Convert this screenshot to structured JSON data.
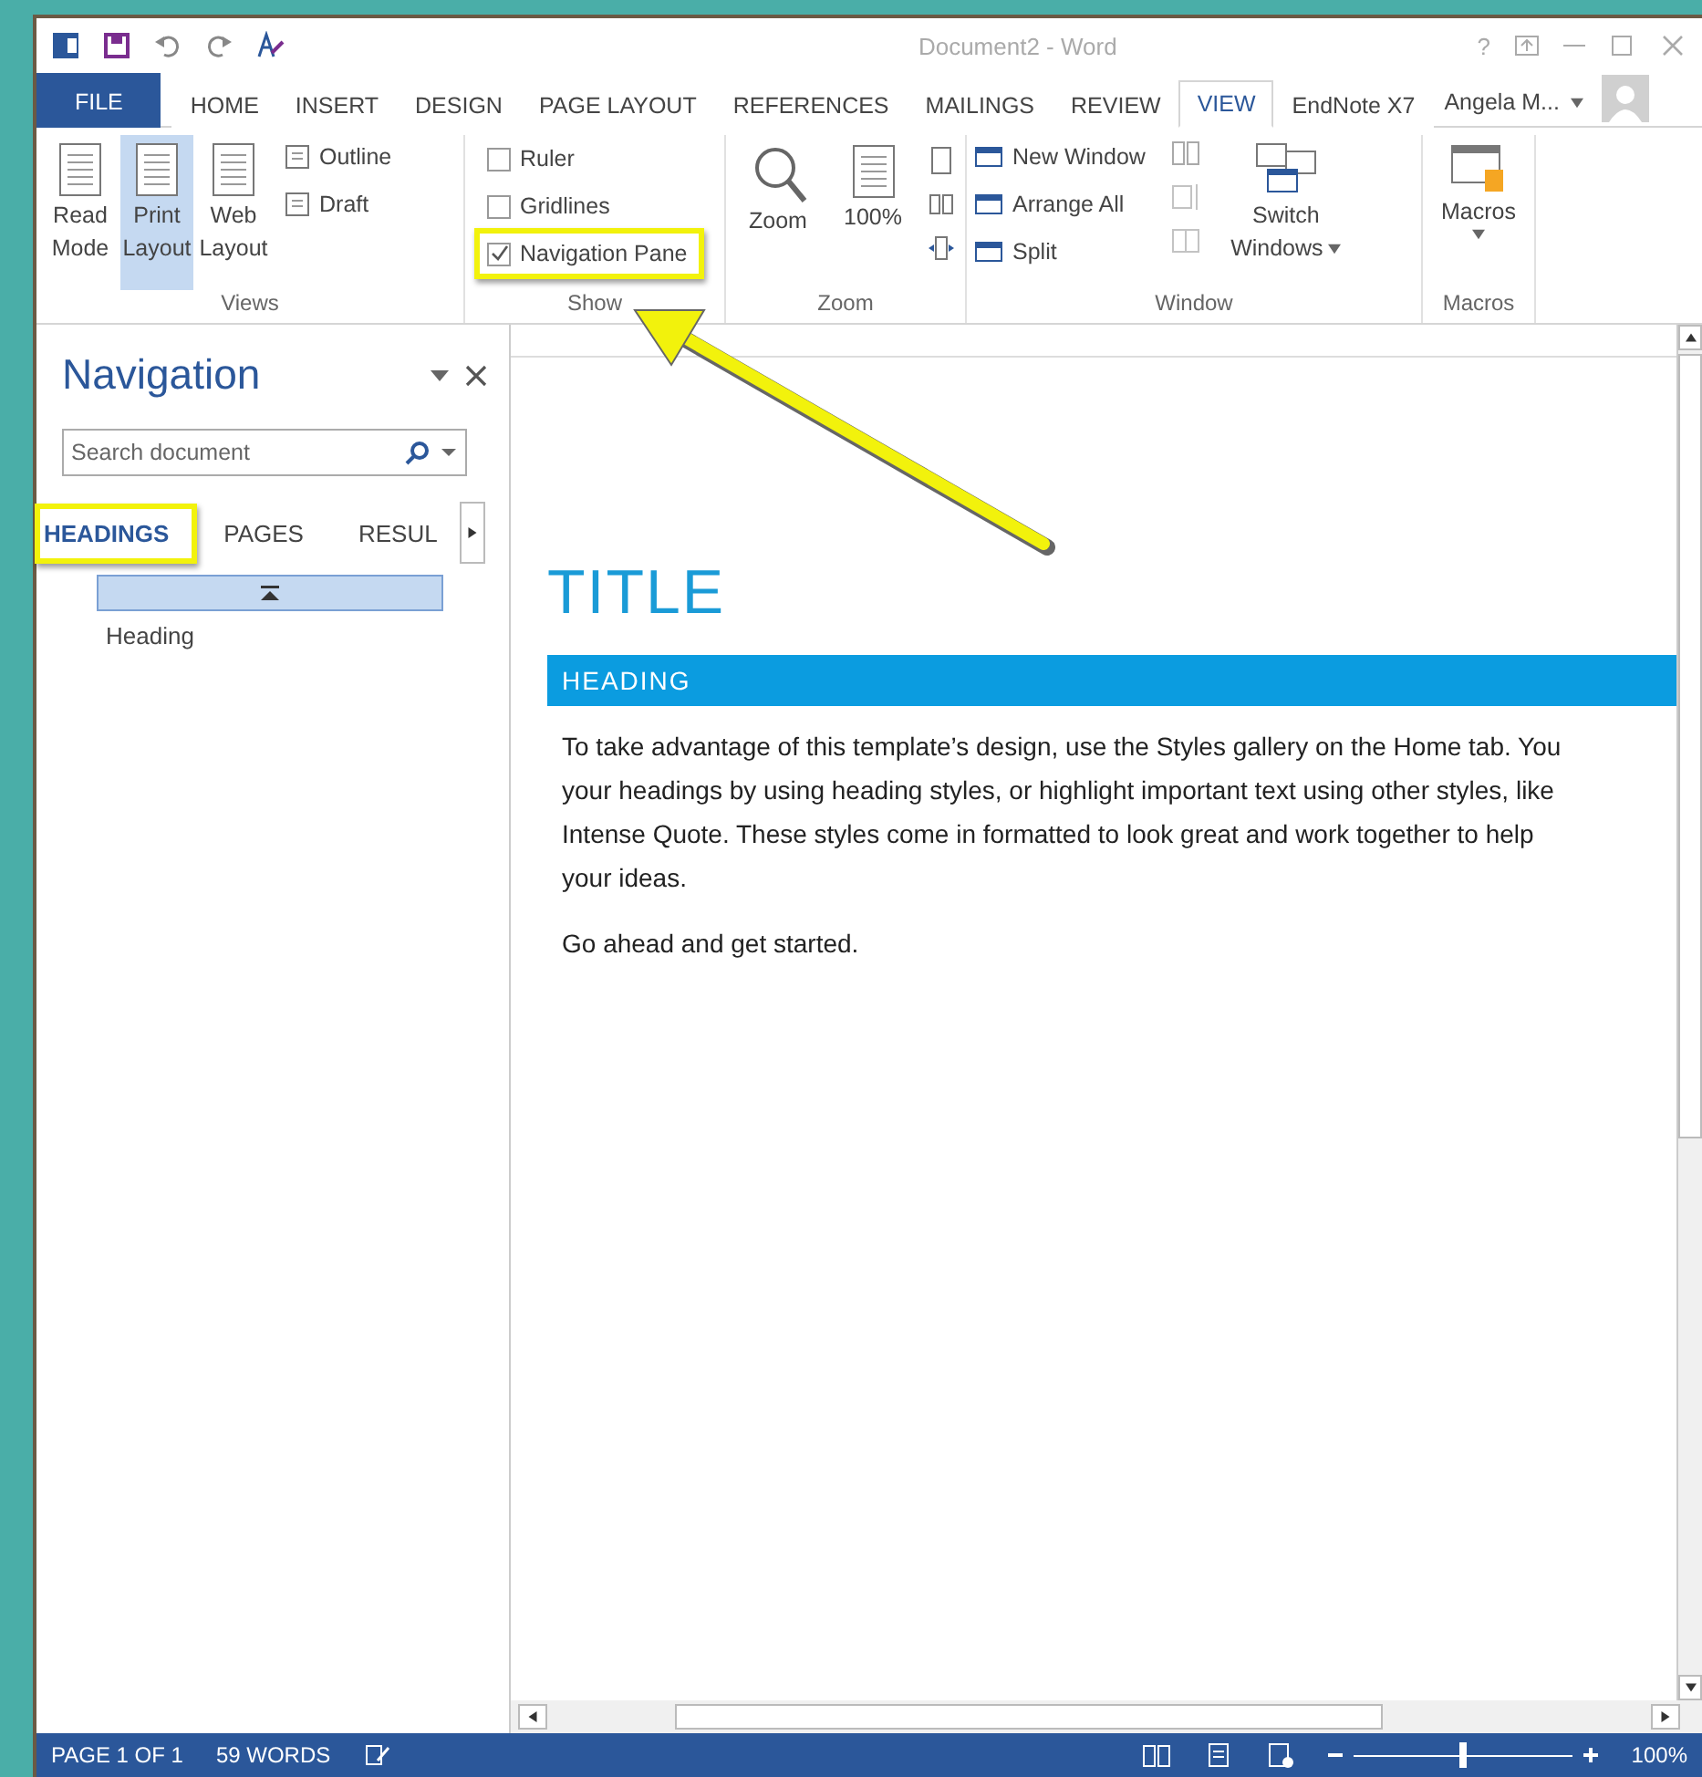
{
  "title_bar": {
    "title": "Document2 - Word",
    "help": "?"
  },
  "ribbon_tabs": [
    {
      "label": "FILE",
      "kind": "file",
      "selected": false
    },
    {
      "label": "HOME",
      "kind": "tab",
      "selected": false
    },
    {
      "label": "INSERT",
      "kind": "tab",
      "selected": false
    },
    {
      "label": "DESIGN",
      "kind": "tab",
      "selected": false
    },
    {
      "label": "PAGE LAYOUT",
      "kind": "tab",
      "selected": false
    },
    {
      "label": "REFERENCES",
      "kind": "tab",
      "selected": false
    },
    {
      "label": "MAILINGS",
      "kind": "tab",
      "selected": false
    },
    {
      "label": "REVIEW",
      "kind": "tab",
      "selected": false
    },
    {
      "label": "VIEW",
      "kind": "tab",
      "selected": true
    },
    {
      "label": "EndNote X7",
      "kind": "tab",
      "selected": false
    }
  ],
  "user": "Angela M...",
  "ribbon": {
    "views": {
      "label": "Views",
      "large": [
        {
          "line1": "Read",
          "line2": "Mode",
          "selected": false
        },
        {
          "line1": "Print",
          "line2": "Layout",
          "selected": true
        },
        {
          "line1": "Web",
          "line2": "Layout",
          "selected": false
        }
      ],
      "small": [
        "Outline",
        "Draft"
      ]
    },
    "show": {
      "label": "Show",
      "checkboxes": [
        {
          "label": "Ruler",
          "checked": false,
          "highlighted": false
        },
        {
          "label": "Gridlines",
          "checked": false,
          "highlighted": false
        },
        {
          "label": "Navigation Pane",
          "checked": true,
          "highlighted": true
        }
      ]
    },
    "zoom": {
      "label": "Zoom",
      "buttons": [
        "Zoom",
        "100%"
      ]
    },
    "window": {
      "label": "Window",
      "small": [
        "New Window",
        "Arrange All",
        "Split"
      ],
      "switch": {
        "line1": "Switch",
        "line2": "Windows"
      }
    },
    "macros": {
      "label": "Macros",
      "button": "Macros"
    }
  },
  "navigation": {
    "title": "Navigation",
    "search": {
      "placeholder": "Search document"
    },
    "tabs": [
      {
        "label": "HEADINGS",
        "selected": true,
        "highlighted": true
      },
      {
        "label": "PAGES",
        "selected": false,
        "highlighted": false
      },
      {
        "label": "RESUL",
        "selected": false,
        "highlighted": false
      }
    ],
    "headings": [
      "Heading"
    ]
  },
  "document": {
    "title": "TITLE",
    "heading": "HEADING",
    "paragraph_lines": [
      "To take advantage of this template’s design, use the Styles gallery on the Home tab. You",
      "your headings by using heading styles, or highlight important text using other styles, like",
      "Intense Quote. These styles come in formatted to look great and work together to help",
      "your ideas."
    ],
    "paragraph_2": "Go ahead and get started."
  },
  "callout_arrow": true,
  "status_bar": {
    "page": "PAGE 1 OF 1",
    "words": "59 WORDS",
    "zoom": "100%",
    "level": 0.5
  }
}
